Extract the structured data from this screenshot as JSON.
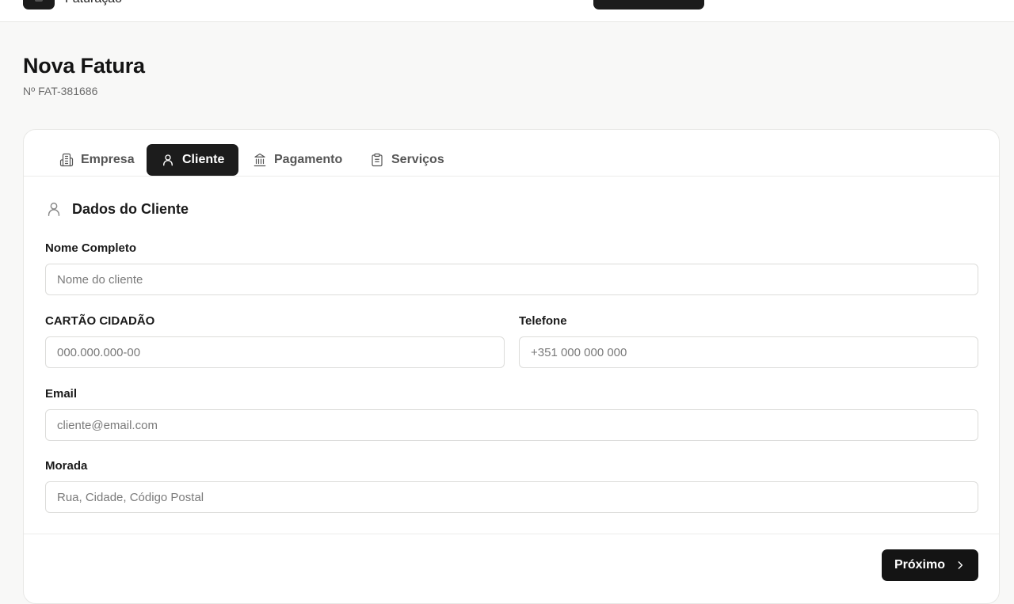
{
  "header": {
    "brand": "Faturação"
  },
  "page": {
    "title": "Nova Fatura",
    "subtitle": "Nº FAT-381686"
  },
  "tabs": [
    {
      "label": "Empresa",
      "icon": "building-icon",
      "active": false
    },
    {
      "label": "Cliente",
      "icon": "user-icon",
      "active": true
    },
    {
      "label": "Pagamento",
      "icon": "bank-icon",
      "active": false
    },
    {
      "label": "Serviços",
      "icon": "clipboard-icon",
      "active": false
    }
  ],
  "section": {
    "title": "Dados do Cliente",
    "icon": "user-icon"
  },
  "fields": {
    "name": {
      "label": "Nome Completo",
      "placeholder": "Nome do cliente",
      "value": ""
    },
    "citizen_card": {
      "label": "CARTÃO CIDADÃO",
      "placeholder": "000.000.000-00",
      "value": ""
    },
    "phone": {
      "label": "Telefone",
      "placeholder": "+351 000 000 000",
      "value": ""
    },
    "email": {
      "label": "Email",
      "placeholder": "cliente@email.com",
      "value": ""
    },
    "address": {
      "label": "Morada",
      "placeholder": "Rua, Cidade, Código Postal",
      "value": ""
    }
  },
  "actions": {
    "next_label": "Próximo",
    "next_icon": "chevron-right-icon"
  },
  "colors": {
    "accent": "#1c1c1c",
    "background": "#f8f8f7",
    "card": "#ffffff",
    "border": "#dcdcda"
  }
}
